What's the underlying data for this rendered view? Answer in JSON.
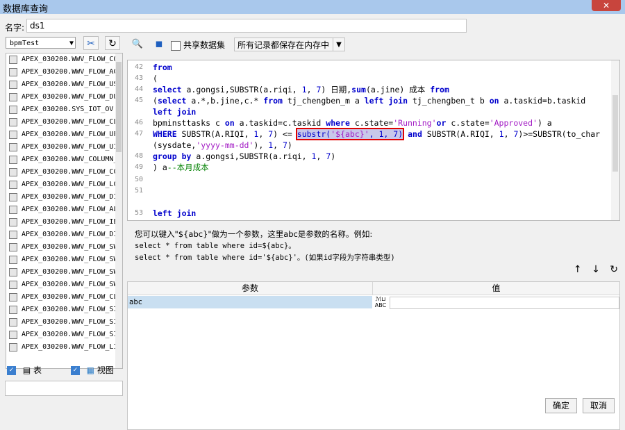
{
  "window": {
    "title": "数据库查询",
    "close_glyph": "✕"
  },
  "name_field": {
    "label": "名字:",
    "value": "ds1"
  },
  "left": {
    "db_select": "bpmTest",
    "tools": {
      "connect_glyph": "✂",
      "refresh_glyph": "↻"
    },
    "tree_items": [
      "APEX_030200.WWV_FLOW_CO",
      "APEX_030200.WWV_FLOW_AC",
      "APEX_030200.WWV_FLOW_US",
      "APEX_030200.WWV_FLOW_DU",
      "APEX_030200.SYS_IOT_OV",
      "APEX_030200.WWV_FLOW_CL",
      "APEX_030200.WWV_FLOW_UF",
      "APEX_030200.WWV_FLOW_UI",
      "APEX_030200.WWV_COLUMN_",
      "APEX_030200.WWV_FLOW_CC",
      "APEX_030200.WWV_FLOW_LC",
      "APEX_030200.WWV_FLOW_DI",
      "APEX_030200.WWV_FLOW_AL",
      "APEX_030200.WWV_FLOW_IE",
      "APEX_030200.WWV_FLOW_DI",
      "APEX_030200.WWV_FLOW_SW",
      "APEX_030200.WWV_FLOW_SW",
      "APEX_030200.WWV_FLOW_SW",
      "APEX_030200.WWV_FLOW_SW",
      "APEX_030200.WWV_FLOW_CL",
      "APEX_030200.WWV_FLOW_SI",
      "APEX_030200.WWV_FLOW_SI",
      "APEX_030200.WWV_FLOW_SI",
      "APEX_030200.WWV_FLOW_LI"
    ],
    "check_table": "表",
    "check_view": "视图"
  },
  "toolbar": {
    "share_label": "共享数据集",
    "memory_select": "所有记录都保存在内存中"
  },
  "editor": {
    "lines": [
      {
        "n": "42",
        "code": "from"
      },
      {
        "n": "43",
        "code": "("
      },
      {
        "n": "44",
        "code": "select a.gongsi,SUBSTR(a.riqi, 1, 7) 日期,sum(a.jine) 成本 from"
      },
      {
        "n": "45",
        "code": "(select a.*,b.jine,c.* from tj_chengben_m a left join tj_chengben_t b on a.taskid=b.taskid"
      },
      {
        "n": "",
        "code": "left join"
      },
      {
        "n": "46",
        "code": "bpminsttasks c on a.taskid=c.taskid where c.state='Running'or c.state='Approved') a"
      },
      {
        "n": "47",
        "code": "WHERE SUBSTR(A.RIQI, 1, 7) <= substr('${abc}', 1, 7) and SUBSTR(A.RIQI, 1, 7)>=SUBSTR(to_char"
      },
      {
        "n": "",
        "code": "(sysdate,'yyyy-mm-dd'), 1, 7)"
      },
      {
        "n": "48",
        "code": "group by a.gongsi,SUBSTR(a.riqi, 1, 7)"
      },
      {
        "n": "49",
        "code": ") a--本月成本"
      },
      {
        "n": "50",
        "code": ""
      },
      {
        "n": "51",
        "code": ""
      },
      {
        "n": "",
        "code": ""
      },
      {
        "n": "53",
        "code": "left join"
      }
    ]
  },
  "hint": {
    "line1": "您可以键入\"${abc}\"做为一个参数，这里abc是参数的名称。例如:",
    "line2": "select * from table where id=${abc}。",
    "line3": "select * from table where id='${abc}'。(如果id字段为字符串类型)"
  },
  "params": {
    "header_param": "参数",
    "header_value": "值",
    "rows": [
      {
        "name": "abc",
        "type_top": "ℳ⊔",
        "type_bottom": "ABC",
        "value": ""
      }
    ]
  },
  "buttons": {
    "ok": "确定",
    "cancel": "取消"
  }
}
